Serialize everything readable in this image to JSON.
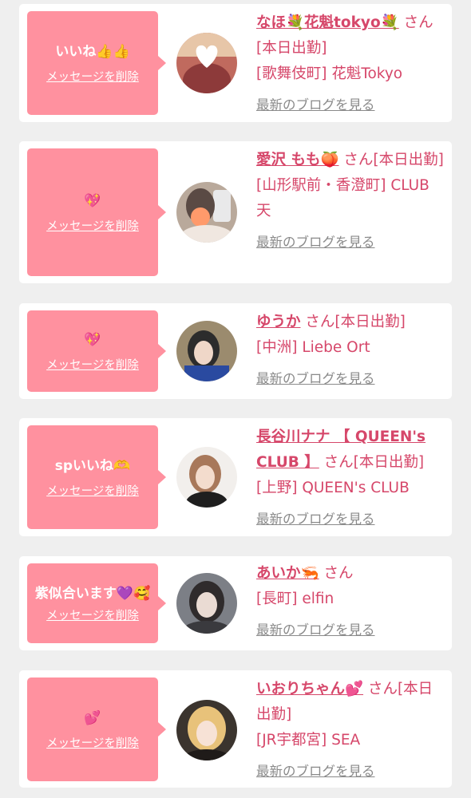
{
  "delete_label": "メッセージを削除",
  "blog_label": "最新のブログを見る",
  "entries": [
    {
      "message": "いいね👍👍",
      "name": "なほ💐花魁tokyo💐",
      "suffix": "さん[本日出勤]",
      "shop": "[歌舞伎町] 花魁Tokyo"
    },
    {
      "message": "💖",
      "name": "愛沢 もも🍑",
      "suffix": "さん[本日出勤]",
      "shop": "[山形駅前・香澄町] CLUB 天"
    },
    {
      "message": "💖",
      "name": "ゆうか",
      "suffix": "さん[本日出勤]",
      "shop": "[中洲] Liebe Ort"
    },
    {
      "message": "spいいね🫶",
      "name": "長谷川ナナ 【 QUEEN's CLUB 】",
      "suffix": "さん[本日出勤]",
      "shop": "[上野] QUEEN's CLUB"
    },
    {
      "message": "紫似合います💜🥰",
      "name": "あいか🦐",
      "suffix": "さん",
      "shop": "[長町] elfin"
    },
    {
      "message": "💕",
      "name": "いおりちゃん💕",
      "suffix": "さん[本日出勤]",
      "shop": "[JR宇都宮] SEA"
    }
  ],
  "colors": {
    "accent": "#d6476a",
    "bubble": "#ff919f",
    "background": "#efefef"
  }
}
